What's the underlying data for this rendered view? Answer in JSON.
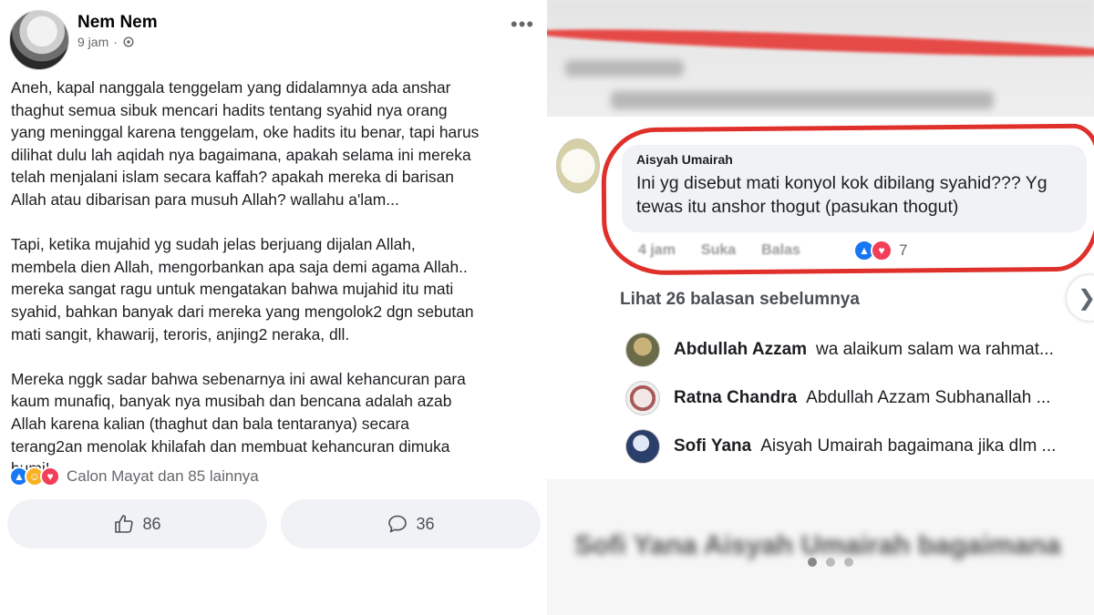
{
  "post": {
    "author": "Nem Nem",
    "time": "9 jam",
    "menu_icon": "more-icon",
    "paragraphs": [
      "Aneh, kapal nanggala tenggelam yang didalamnya ada anshar\nthaghut semua sibuk mencari hadits tentang syahid nya orang\nyang meninggal karena tenggelam, oke hadits itu benar, tapi harus\ndilihat dulu lah aqidah nya bagaimana, apakah selama ini mereka\ntelah menjalani islam secara kaffah? apakah mereka di barisan\nAllah atau dibarisan para musuh Allah? wallahu a'lam...",
      "Tapi, ketika mujahid yg sudah jelas berjuang dijalan Allah,\nmembela dien Allah, mengorbankan apa saja demi agama Allah..\nmereka sangat ragu untuk mengatakan bahwa mujahid itu mati\nsyahid, bahkan banyak dari mereka yang mengolok2 dgn sebutan\nmati sangit, khawarij, teroris, anjing2 neraka, dll.",
      "Mereka nggk sadar bahwa sebenarnya ini awal kehancuran para\nkaum munafiq, banyak nya musibah dan bencana adalah azab\nAllah karena kalian (thaghut dan bala tentaranya) secara\nterang2an menolak khilafah dan membuat kehancuran dimuka\nbumi!"
    ],
    "reactions_text": "Calon Mayat dan 85 lainnya",
    "like_count": "86",
    "comment_count": "36"
  },
  "comment": {
    "author": "Aisyah Umairah",
    "text": "Ini yg disebut mati konyol kok dibilang syahid??? Yg tewas itu anshor thogut (pasukan thogut)",
    "time": "4 jam",
    "like_label": "Suka",
    "reply_label": "Balas",
    "reaction_count": "7"
  },
  "previous_replies": "Lihat 26 balasan sebelumnya",
  "replies": [
    {
      "name": "Abdullah Azzam",
      "text": "wa alaikum salam wa rahmat..."
    },
    {
      "name": "Ratna Chandra",
      "text": "Abdullah Azzam Subhanallah ..."
    },
    {
      "name": "Sofi Yana",
      "text": "Aisyah Umairah bagaimana jika dlm ..."
    }
  ],
  "blurred": {
    "top_name": "Aisyah Umairah",
    "top_text": "Ini yg disebut mati konyol kok dibilang syahid",
    "bottom_text": "Sofi Yana  Aisyah Umairah bagaimana"
  },
  "colors": {
    "accent": "#1877f2",
    "annotation_red": "#e0302b",
    "bubble": "#f0f2f5"
  }
}
